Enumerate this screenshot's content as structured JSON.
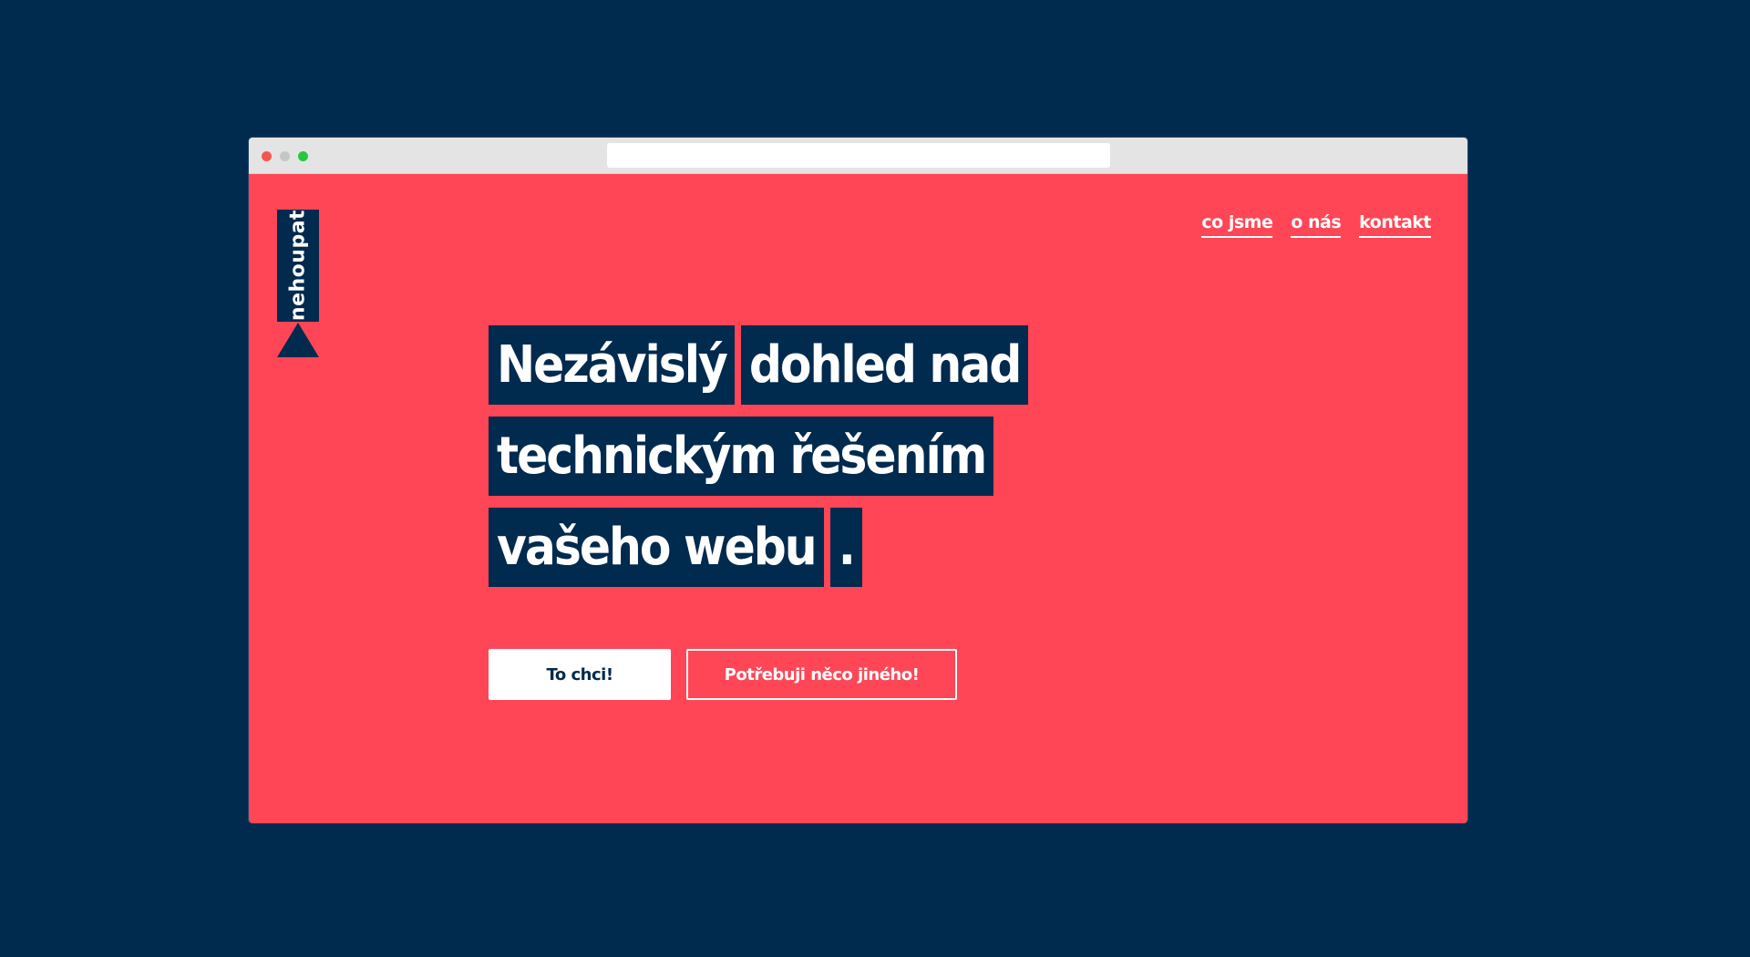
{
  "colors": {
    "background": "#002a4e",
    "brand_red": "#ff4656",
    "navy": "#002a4e",
    "white": "#ffffff"
  },
  "logo": {
    "text": "nehoupat"
  },
  "nav": {
    "items": [
      {
        "label": "co jsme"
      },
      {
        "label": "o nás"
      },
      {
        "label": "kontakt"
      }
    ]
  },
  "hero": {
    "line1": [
      "Nezávislý",
      "dohled nad"
    ],
    "line2": [
      "technickým řešením"
    ],
    "line3": [
      "vašeho webu",
      "."
    ]
  },
  "buttons": {
    "primary_label": "To chci!",
    "secondary_label": "Potřebuji něco jiného!"
  }
}
